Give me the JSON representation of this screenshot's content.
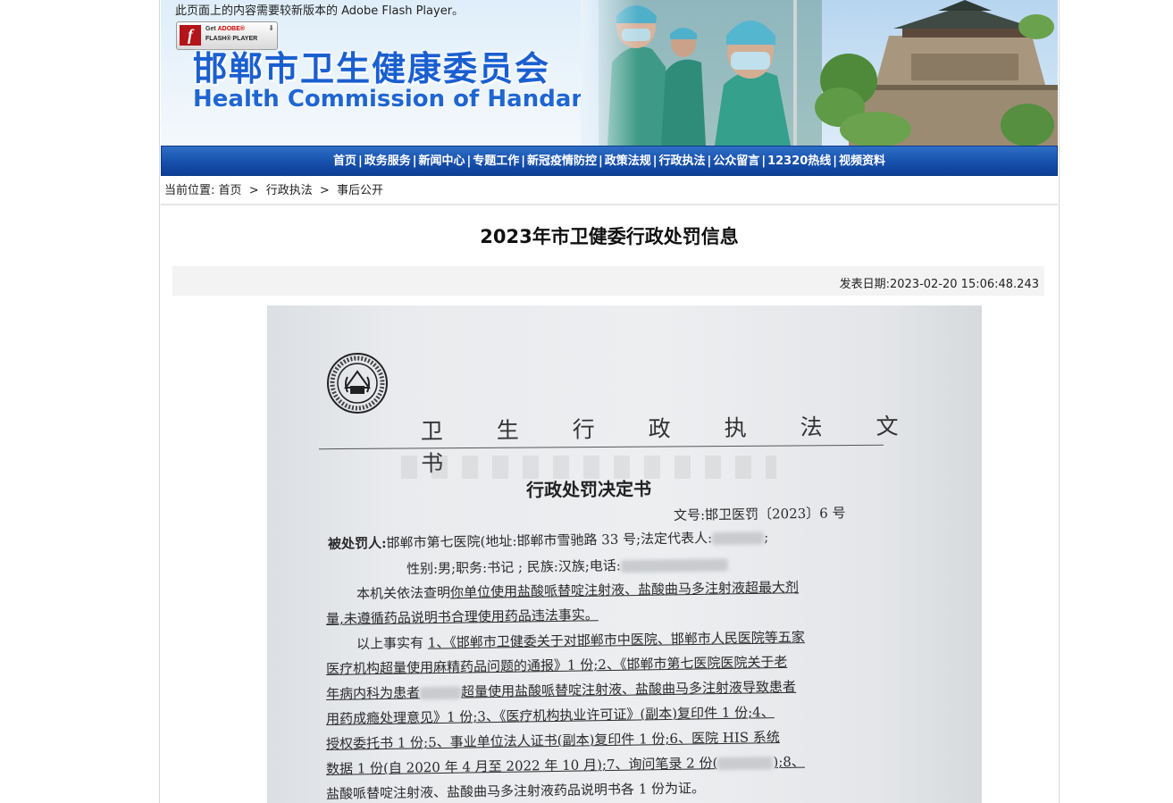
{
  "banner": {
    "flash_notice": "此页面上的内容需要较新版本的 Adobe Flash Player。",
    "flash_button": {
      "line1_a": "Get ",
      "line1_b": "ADOBE®",
      "line2": "FLASH® PLAYER"
    },
    "title_cn": "邯郸市卫生健康委员会",
    "title_en": "Health Commission of Handan"
  },
  "nav": {
    "items": [
      "首页",
      "政务服务",
      "新闻中心",
      "专题工作",
      "新冠疫情防控",
      "政策法规",
      "行政执法",
      "公众留言",
      "12320热线",
      "视频资料"
    ],
    "separator": "|"
  },
  "breadcrumb": {
    "prefix": "当前位置:",
    "items": [
      "首页",
      "行政执法",
      "事后公开"
    ],
    "separator": ">"
  },
  "article": {
    "title": "2023年市卫健委行政处罚信息",
    "publish_label": "发表日期:",
    "publish_date": "2023-02-20 15:06:48.243"
  },
  "document": {
    "heading": "卫 生 行 政 执 法 文 书",
    "subheading": "行政处罚决定书",
    "doc_no": "文号:邯卫医罚〔2023〕6 号",
    "party_label": "被处罚人:",
    "party": "邯郸市第七医院(地址:邯郸市雪驰路 33 号;法定代表人:",
    "party_tail": ";",
    "personal": "性别:男;职务:书记 ; 民族:汉族;电话:",
    "p1_a": "本机关依法查明",
    "p1_b": "你单位使用盐酸哌替啶注射液、盐酸曲马多注射液超最大剂",
    "p2": "量,未遵循药品说明书合理使用药品违法事实。",
    "p3_a": "以上事实有 ",
    "p3_b": "1、《邯郸市卫健委关于对邯郸市中医院、邯郸市人民医院等五家",
    "p4": "医疗机构超量使用麻精药品问题的通报》1 份;2、《邯郸市第七医院医院关于老",
    "p5_a": "年病内科为患者",
    "p5_b": "超量使用盐酸哌替啶注射液、盐酸曲马多注射液导致患者",
    "p6": "用药成瘾处理意见》1 份;3、《医疗机构执业许可证》(副本)复印件 1 份;4、",
    "p7": "授权委托书 1 份;5、事业单位法人证书(副本)复印件 1 份;6、医院 HIS 系统",
    "p8_a": "数据 1 份(自 2020 年 4 月至 2022 年 10 月);7、询问笔录 2 份(",
    "p8_b": ");8、",
    "p9": "盐酸哌替啶注射液、盐酸曲马多注射液药品说明书各 1 份为证。"
  },
  "colors": {
    "nav_blue": "#1750ac",
    "title_blue": "#1a5fd0",
    "meta_bg": "#f3f3f3"
  }
}
